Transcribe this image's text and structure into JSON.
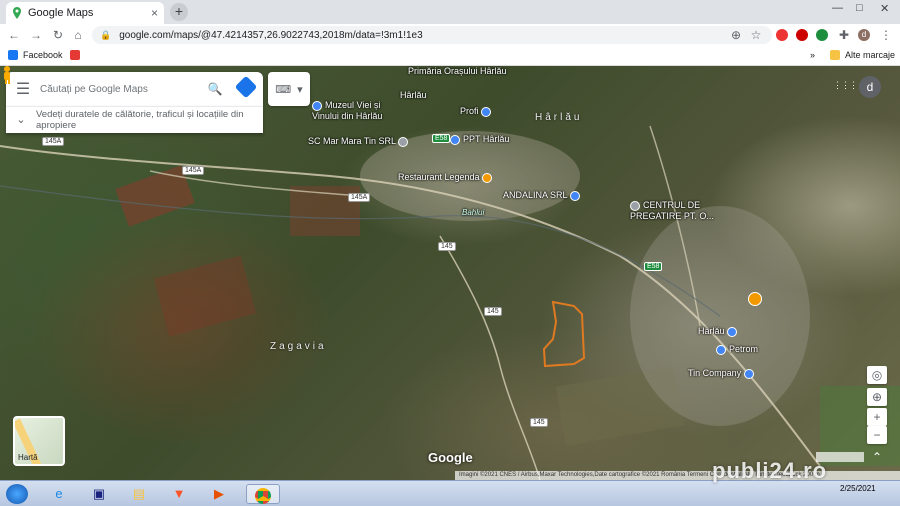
{
  "browser": {
    "tab_title": "Google Maps",
    "tab_close": "×",
    "new_tab": "+",
    "url": "google.com/maps/@47.4214357,26.9022743,2018m/data=!3m1!1e3",
    "win_min": "—",
    "win_max": "□",
    "win_close": "✕",
    "profile_initial": "d"
  },
  "bookmarks": {
    "items": [
      "Facebook"
    ],
    "more": "»",
    "other": "Alte marcaje"
  },
  "map": {
    "search_placeholder": "Căutați pe Google Maps",
    "suggestion": "Vedeți duratele de călătorie, traficul și locațiile din apropiere",
    "pois": [
      "Primăria Orașului Hârlău",
      "Muzeul Viei și\nVinului din Hârlău",
      "Hârlău",
      "Profi",
      "PPT Hârlău",
      "SC Mar Mara Tin SRL",
      "Restaurant Legenda",
      "ANDALINA SRL",
      "CENTRUL DE\nPREGATIRE PT. O...",
      "Hârlău",
      "Petrom",
      "Tin Company"
    ],
    "area_labels": [
      "Hârlău",
      "Zagavia"
    ],
    "roads": [
      "145A",
      "145A",
      "145A",
      "145",
      "145",
      "145",
      "E58",
      "E58"
    ],
    "river": "Bahlui",
    "minimap_label": "Hartă",
    "google": "Google",
    "footer": "Imagini ©2021 CNES / Airbus,Maxar Technologies,Date cartografice ©2021   România   Termeni   Confidențialitate   Trimiteți feedback   200 m",
    "apps_icon": "⋮⋮⋮",
    "account_initial": "d"
  },
  "taskbar": {
    "clock_time": "",
    "clock_date": "2/25/2021",
    "watermark": "publi24.ro"
  },
  "colors": {
    "parcel_outline": "#e07a20",
    "poi_blue": "#4285f4",
    "poi_orange": "#f29900"
  }
}
